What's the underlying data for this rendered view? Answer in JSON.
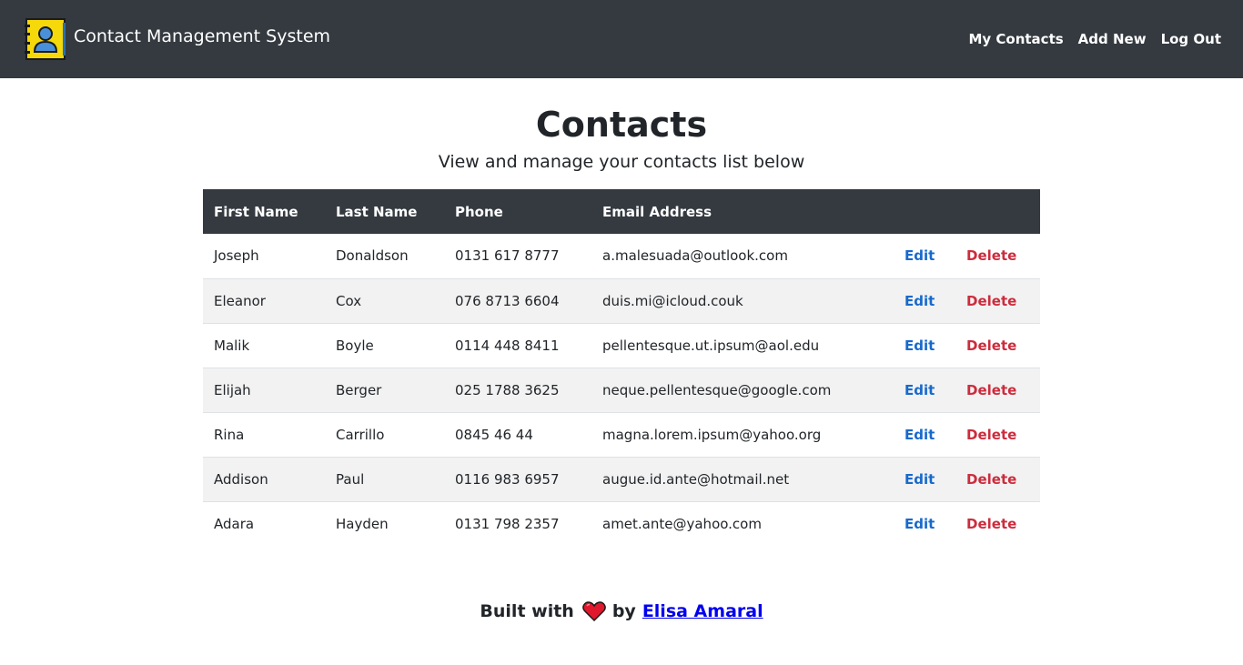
{
  "navbar": {
    "brand_title": "Contact Management System",
    "logo_icon": "address-book-icon",
    "links": [
      "My Contacts",
      "Add New",
      "Log Out"
    ]
  },
  "page": {
    "title": "Contacts",
    "subtitle": "View and manage your contacts list below"
  },
  "table": {
    "headers": [
      "First Name",
      "Last Name",
      "Phone",
      "Email Address"
    ],
    "rows": [
      {
        "first": "Joseph",
        "last": "Donaldson",
        "phone": "0131 617 8777",
        "email": "a.malesuada@outlook.com",
        "edit": "Edit",
        "delete": "Delete"
      },
      {
        "first": "Eleanor",
        "last": "Cox",
        "phone": "076 8713 6604",
        "email": "duis.mi@icloud.couk",
        "edit": "Edit",
        "delete": "Delete"
      },
      {
        "first": "Malik",
        "last": "Boyle",
        "phone": "0114 448 8411",
        "email": "pellentesque.ut.ipsum@aol.edu",
        "edit": "Edit",
        "delete": "Delete"
      },
      {
        "first": "Elijah",
        "last": "Berger",
        "phone": "025 1788 3625",
        "email": "neque.pellentesque@google.com",
        "edit": "Edit",
        "delete": "Delete"
      },
      {
        "first": "Rina",
        "last": "Carrillo",
        "phone": "0845 46 44",
        "email": "magna.lorem.ipsum@yahoo.org",
        "edit": "Edit",
        "delete": "Delete"
      },
      {
        "first": "Addison",
        "last": "Paul",
        "phone": "0116 983 6957",
        "email": "augue.id.ante@hotmail.net",
        "edit": "Edit",
        "delete": "Delete"
      },
      {
        "first": "Adara",
        "last": "Hayden",
        "phone": "0131 798 2357",
        "email": "amet.ante@yahoo.com",
        "edit": "Edit",
        "delete": "Delete"
      }
    ]
  },
  "footer": {
    "built_with": "Built with",
    "heart_icon": "heart-icon",
    "by": "by",
    "author": "Elisa Amaral"
  },
  "colors": {
    "navbar_bg": "#343a40",
    "edit": "#1769cc",
    "delete": "#cc2c3d",
    "logo_yellow": "#f5d90a",
    "heart": "#e0182d"
  }
}
